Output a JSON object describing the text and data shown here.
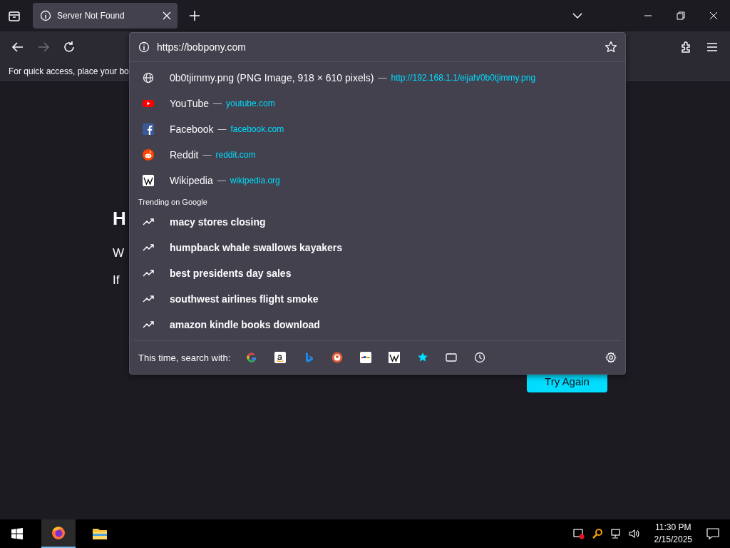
{
  "tabs": [
    {
      "title": "Server Not Found",
      "selected": true
    }
  ],
  "address_bar": {
    "value": "https://bobpony.com"
  },
  "bookmarks_bar": {
    "text": "For quick access, place your bo"
  },
  "suggestions": [
    {
      "kind": "globe",
      "title": "0b0tjimmy.png (PNG Image, 918 × 610 pixels)",
      "separator": "—",
      "url": "http://192.168.1.1/eijah/0b0tjimmy.png"
    },
    {
      "kind": "youtube",
      "title": "YouTube",
      "separator": "—",
      "url": "youtube.com"
    },
    {
      "kind": "facebook",
      "title": "Facebook",
      "separator": "—",
      "url": "facebook.com"
    },
    {
      "kind": "reddit",
      "title": "Reddit",
      "separator": "—",
      "url": "reddit.com"
    },
    {
      "kind": "wikipedia",
      "title": "Wikipedia",
      "separator": "—",
      "url": "wikipedia.org"
    }
  ],
  "trending": {
    "label": "Trending on Google",
    "items": [
      "macy stores closing",
      "humpback whale swallows kayakers",
      "best presidents day sales",
      "southwest airlines flight smoke",
      "amazon kindle books download"
    ]
  },
  "search_with": {
    "label": "This time, search with:",
    "engines": [
      {
        "kind": "google"
      },
      {
        "kind": "amazon"
      },
      {
        "kind": "bing"
      },
      {
        "kind": "duckduckgo"
      },
      {
        "kind": "ebay"
      },
      {
        "kind": "wikipedia"
      },
      {
        "kind": "bookmarks"
      },
      {
        "kind": "tabs"
      },
      {
        "kind": "history"
      }
    ]
  },
  "page": {
    "heading": "H",
    "lines": [
      "W",
      "If"
    ],
    "button": "Try Again"
  },
  "taskbar": {
    "time": "11:30 PM",
    "date": "2/15/2025"
  }
}
